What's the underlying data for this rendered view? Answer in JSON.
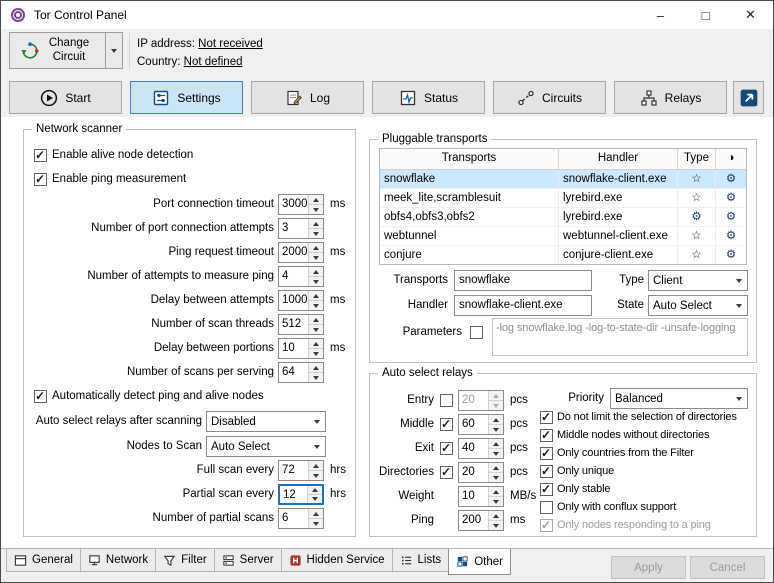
{
  "window": {
    "title": "Tor Control Panel",
    "minimize_glyph": "–",
    "maximize_glyph": "□",
    "close_glyph": "✕"
  },
  "toolbar": {
    "change_circuit_label": "Change Circuit",
    "ip_label": "IP address:",
    "ip_value": "Not received",
    "country_label": "Country:",
    "country_value": "Not defined"
  },
  "main_tabs": [
    {
      "label": "Start",
      "active": false
    },
    {
      "label": "Settings",
      "active": true
    },
    {
      "label": "Log",
      "active": false
    },
    {
      "label": "Status",
      "active": false
    },
    {
      "label": "Circuits",
      "active": false
    },
    {
      "label": "Relays",
      "active": false
    }
  ],
  "network_scanner": {
    "title": "Network scanner",
    "alive_checkbox_label": "Enable alive node detection",
    "alive_checked": true,
    "ping_checkbox_label": "Enable ping measurement",
    "ping_checked": true,
    "spin_rows": [
      {
        "label": "Port connection timeout",
        "value": "3000",
        "unit": "ms"
      },
      {
        "label": "Number of port connection attempts",
        "value": "3",
        "unit": ""
      },
      {
        "label": "Ping request timeout",
        "value": "2000",
        "unit": "ms"
      },
      {
        "label": "Number of attempts to measure ping",
        "value": "4",
        "unit": ""
      },
      {
        "label": "Delay between attempts",
        "value": "1000",
        "unit": "ms"
      },
      {
        "label": "Number of scan threads",
        "value": "512",
        "unit": ""
      },
      {
        "label": "Delay between portions",
        "value": "10",
        "unit": "ms"
      },
      {
        "label": "Number of scans per serving",
        "value": "64",
        "unit": ""
      }
    ],
    "auto_detect_checkbox_label": "Automatically detect ping and alive nodes",
    "auto_detect_checked": true,
    "combo_rows": [
      {
        "label": "Auto select relays after scanning",
        "value": "Disabled"
      },
      {
        "label": "Nodes to Scan",
        "value": "Auto Select"
      }
    ],
    "bottom_spin_rows": [
      {
        "label": "Full scan every",
        "value": "72",
        "unit": "hrs"
      },
      {
        "label": "Partial scan every",
        "value": "12",
        "unit": "hrs",
        "focused": true
      },
      {
        "label": "Number of partial scans",
        "value": "6",
        "unit": ""
      }
    ]
  },
  "pluggable_transports": {
    "title": "Pluggable transports",
    "table": {
      "headers": [
        "Transports",
        "Handler",
        "Type",
        "◑"
      ],
      "rows": [
        {
          "transport": "snowflake",
          "handler": "snowflake-client.exe",
          "type_icon": "☆",
          "state_icon": "⚙",
          "selected": true
        },
        {
          "transport": "meek_lite,scramblesuit",
          "handler": "lyrebird.exe",
          "type_icon": "☆",
          "state_icon": "⚙",
          "selected": false
        },
        {
          "transport": "obfs4,obfs3,obfs2",
          "handler": "lyrebird.exe",
          "type_icon": "⚙",
          "state_icon": "⚙",
          "selected": false
        },
        {
          "transport": "webtunnel",
          "handler": "webtunnel-client.exe",
          "type_icon": "☆",
          "state_icon": "⚙",
          "selected": false
        },
        {
          "transport": "conjure",
          "handler": "conjure-client.exe",
          "type_icon": "☆",
          "state_icon": "⚙",
          "selected": false
        }
      ]
    },
    "transports_label": "Transports",
    "transports_value": "snowflake",
    "type_label": "Type",
    "type_value": "Client",
    "handler_label": "Handler",
    "handler_value": "snowflake-client.exe",
    "state_label": "State",
    "state_value": "Auto Select",
    "parameters_label": "Parameters",
    "parameters_checked": false,
    "parameters_value": "-log snowflake.log -log-to-state-dir -unsafe-logging"
  },
  "auto_select_relays": {
    "title": "Auto select relays",
    "priority_label": "Priority",
    "priority_value": "Balanced",
    "quota_rows": [
      {
        "label": "Entry",
        "value": "20",
        "unit": "pcs",
        "checked": false,
        "disabled": true
      },
      {
        "label": "Middle",
        "value": "60",
        "unit": "pcs",
        "checked": true,
        "disabled": false
      },
      {
        "label": "Exit",
        "value": "40",
        "unit": "pcs",
        "checked": true,
        "disabled": false
      },
      {
        "label": "Directories",
        "value": "20",
        "unit": "pcs",
        "checked": true,
        "disabled": false
      },
      {
        "label": "Weight",
        "value": "10",
        "unit": "MB/s"
      },
      {
        "label": "Ping",
        "value": "200",
        "unit": "ms"
      }
    ],
    "option_checkboxes": [
      {
        "label": "Do not limit the selection of directories",
        "checked": true,
        "disabled": false
      },
      {
        "label": "Middle nodes without directories",
        "checked": true,
        "disabled": false
      },
      {
        "label": "Only countries from the Filter",
        "checked": true,
        "disabled": false
      },
      {
        "label": "Only unique",
        "checked": true,
        "disabled": false
      },
      {
        "label": "Only stable",
        "checked": true,
        "disabled": false
      },
      {
        "label": "Only with conflux support",
        "checked": false,
        "disabled": false
      },
      {
        "label": "Only nodes responding to a ping",
        "checked": true,
        "disabled": true
      }
    ]
  },
  "bottom_tabs": [
    {
      "label": "General",
      "active": false
    },
    {
      "label": "Network",
      "active": false
    },
    {
      "label": "Filter",
      "active": false
    },
    {
      "label": "Server",
      "active": false
    },
    {
      "label": "Hidden Service",
      "active": false
    },
    {
      "label": "Lists",
      "active": false
    },
    {
      "label": "Other",
      "active": true
    }
  ],
  "footer": {
    "apply_label": "Apply",
    "cancel_label": "Cancel",
    "apply_enabled": false,
    "cancel_enabled": false
  }
}
